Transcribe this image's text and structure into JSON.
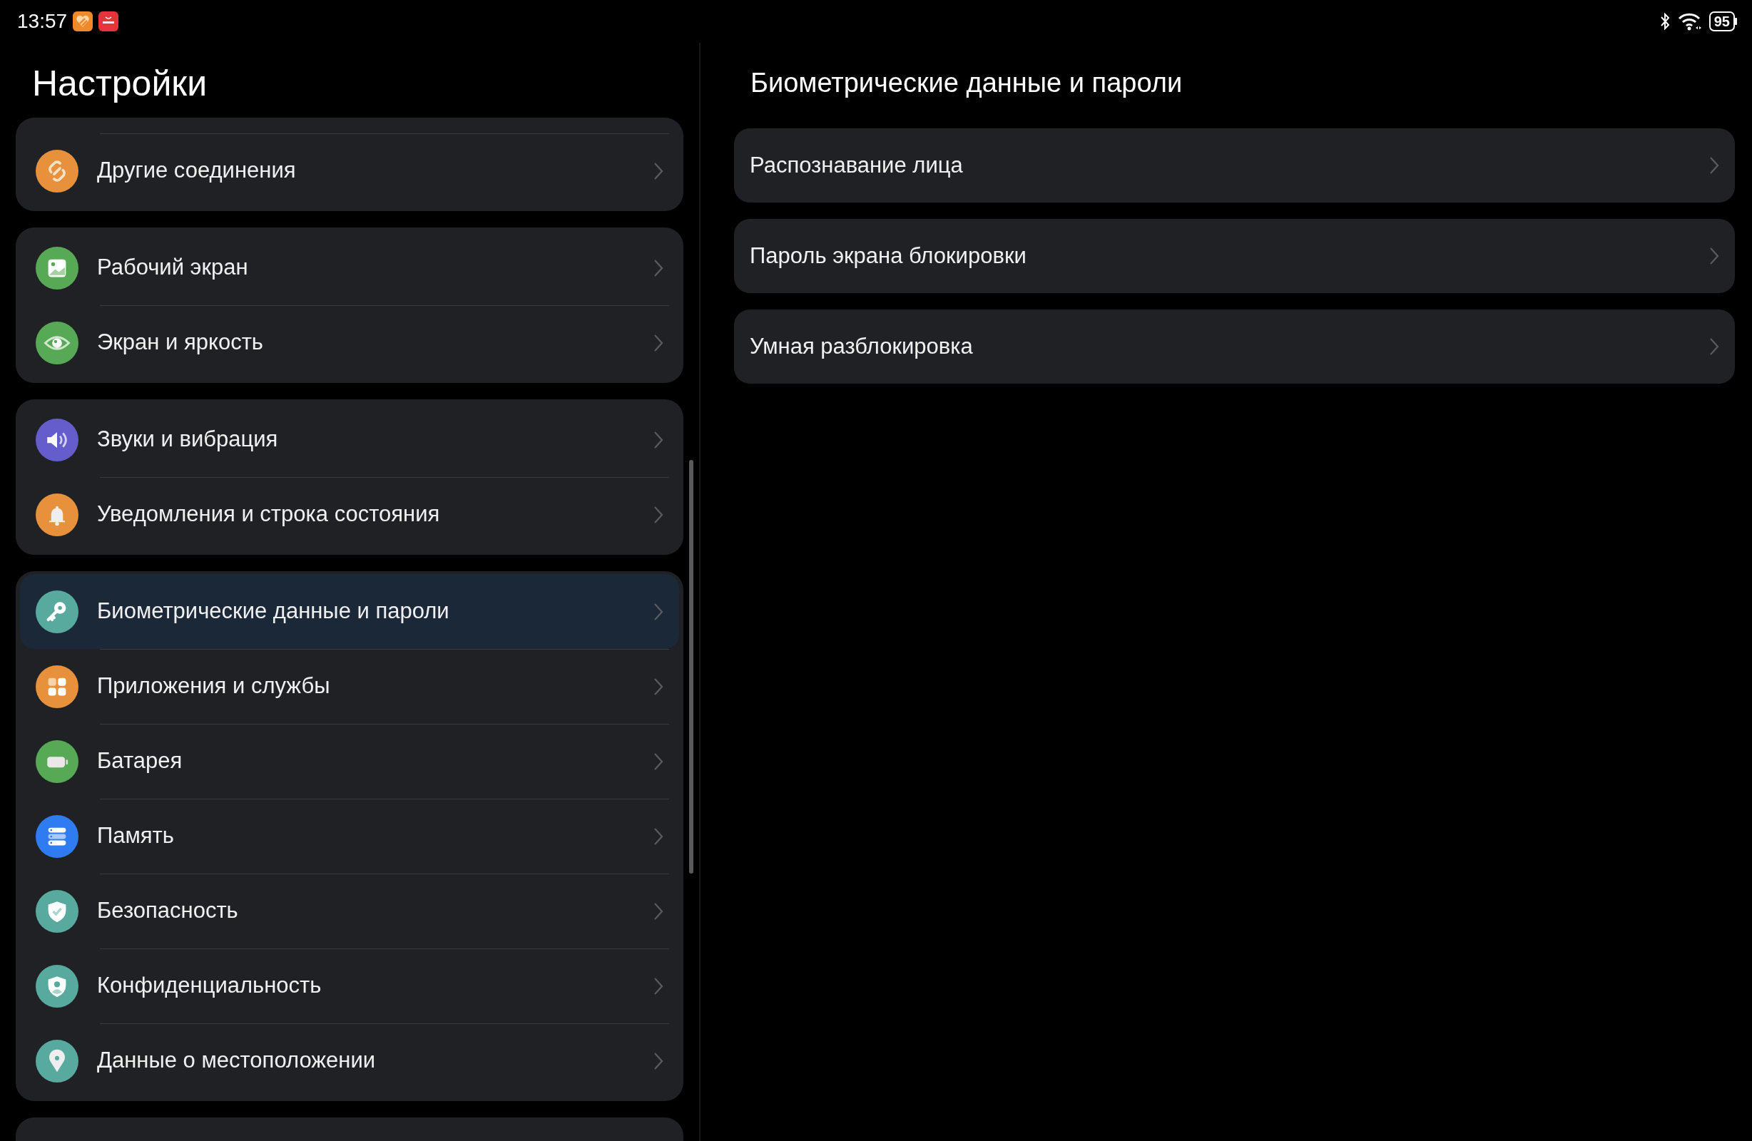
{
  "status_bar": {
    "time": "13:57",
    "battery": "95"
  },
  "sidebar": {
    "title": "Настройки",
    "groups": [
      {
        "items": [
          {
            "label": "Другие соединения",
            "kind": "link",
            "color": "#e8913c",
            "selected": false
          }
        ]
      },
      {
        "items": [
          {
            "label": "Рабочий экран",
            "kind": "picture",
            "color": "#58a955",
            "selected": false
          },
          {
            "label": "Экран и яркость",
            "kind": "eye",
            "color": "#58a955",
            "selected": false
          }
        ]
      },
      {
        "items": [
          {
            "label": "Звуки и вибрация",
            "kind": "speaker",
            "color": "#665dcc",
            "selected": false
          },
          {
            "label": "Уведомления и строка состояния",
            "kind": "bell",
            "color": "#e8913c",
            "selected": false
          }
        ]
      },
      {
        "items": [
          {
            "label": "Биометрические данные и пароли",
            "kind": "key",
            "color": "#58aa9e",
            "selected": true
          },
          {
            "label": "Приложения и службы",
            "kind": "grid",
            "color": "#e8913c",
            "selected": false
          },
          {
            "label": "Батарея",
            "kind": "battery",
            "color": "#58a955",
            "selected": false
          },
          {
            "label": "Память",
            "kind": "storage",
            "color": "#2f7bf2",
            "selected": false
          },
          {
            "label": "Безопасность",
            "kind": "shield",
            "color": "#58aa9e",
            "selected": false
          },
          {
            "label": "Конфиденциальность",
            "kind": "person-shield",
            "color": "#58aa9e",
            "selected": false
          },
          {
            "label": "Данные о местоположении",
            "kind": "pin",
            "color": "#58aa9e",
            "selected": false
          }
        ]
      }
    ]
  },
  "detail": {
    "title": "Биометрические данные и пароли",
    "items": [
      {
        "label": "Распознавание лица"
      },
      {
        "label": "Пароль экрана блокировки"
      },
      {
        "label": "Умная разблокировка"
      }
    ]
  }
}
